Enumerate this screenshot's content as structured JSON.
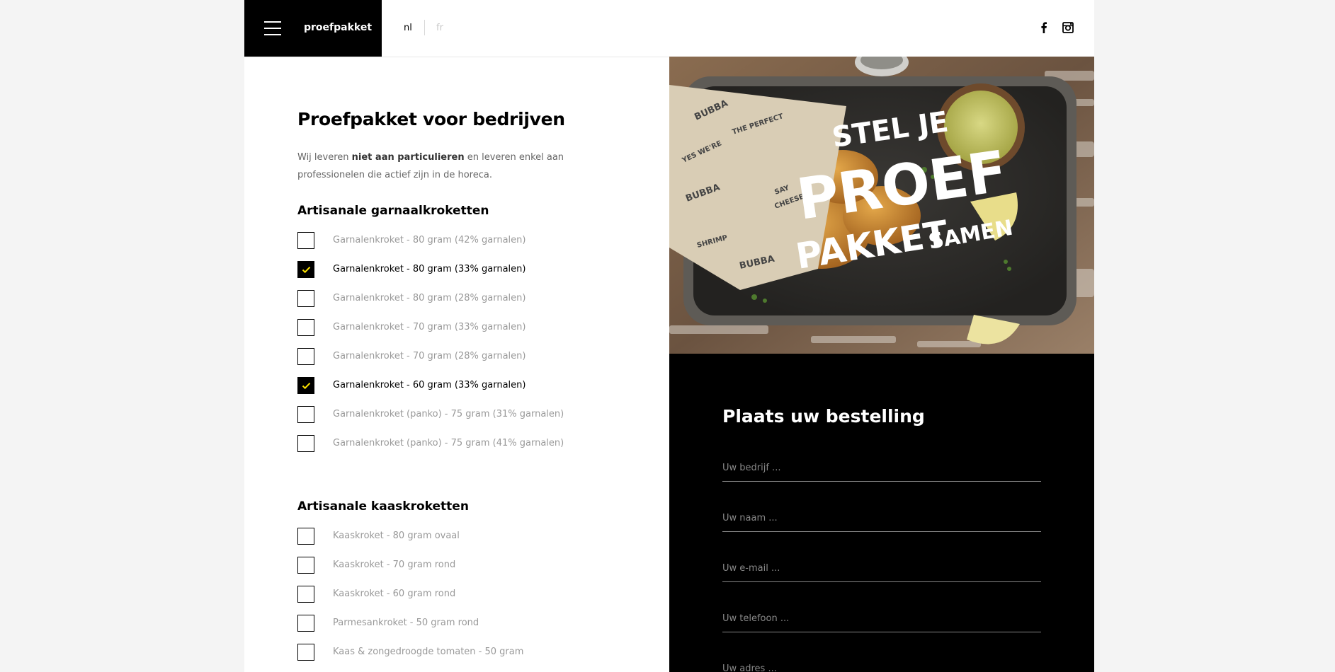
{
  "header": {
    "brand": "proefpakket",
    "languages": [
      {
        "code": "nl",
        "active": true
      },
      {
        "code": "fr",
        "active": false
      }
    ],
    "social": [
      "facebook-icon",
      "instagram-icon"
    ]
  },
  "main": {
    "title": "Proefpakket voor bedrijven",
    "intro": {
      "before": "Wij leveren ",
      "bold": "niet aan particulieren",
      "after": " en leveren enkel aan professionelen die actief zijn in de horeca."
    },
    "sections": [
      {
        "title": "Artisanale garnaalkroketten",
        "options": [
          {
            "label": "Garnalenkroket - 80 gram (42% garnalen)",
            "checked": false
          },
          {
            "label": "Garnalenkroket - 80 gram (33% garnalen)",
            "checked": true
          },
          {
            "label": "Garnalenkroket - 80 gram (28% garnalen)",
            "checked": false
          },
          {
            "label": "Garnalenkroket - 70 gram (33% garnalen)",
            "checked": false
          },
          {
            "label": "Garnalenkroket - 70 gram (28% garnalen)",
            "checked": false
          },
          {
            "label": "Garnalenkroket - 60 gram (33% garnalen)",
            "checked": true
          },
          {
            "label": "Garnalenkroket (panko) - 75 gram (31% garnalen)",
            "checked": false
          },
          {
            "label": "Garnalenkroket (panko) - 75 gram (41% garnalen)",
            "checked": false
          }
        ]
      },
      {
        "title": "Artisanale kaaskroketten",
        "options": [
          {
            "label": "Kaaskroket - 80 gram ovaal",
            "checked": false
          },
          {
            "label": "Kaaskroket - 70 gram rond",
            "checked": false
          },
          {
            "label": "Kaaskroket - 60 gram rond",
            "checked": false
          },
          {
            "label": "Parmesankroket - 50 gram rond",
            "checked": false
          },
          {
            "label": "Kaas & zongedroogde tomaten - 50 gram",
            "checked": false
          }
        ]
      }
    ]
  },
  "hero": {
    "headline": [
      "STEL JE",
      "PROEF",
      "PAKKET",
      "SAMEN"
    ],
    "wrapper_prints": [
      "BUBBA",
      "THE PERFECT SNACK",
      "SAY CHEESE",
      "YES WE'RE SHRIMP"
    ]
  },
  "order_form": {
    "title": "Plaats uw bestelling",
    "fields": [
      {
        "placeholder": "Uw bedrijf ...",
        "value": ""
      },
      {
        "placeholder": "Uw naam ...",
        "value": ""
      },
      {
        "placeholder": "Uw e-mail ...",
        "value": ""
      },
      {
        "placeholder": "Uw telefoon ...",
        "value": ""
      },
      {
        "placeholder": "Uw adres ...",
        "value": ""
      }
    ]
  },
  "colors": {
    "accent": "#ffe500",
    "black": "#000000",
    "muted_text": "#999999"
  }
}
